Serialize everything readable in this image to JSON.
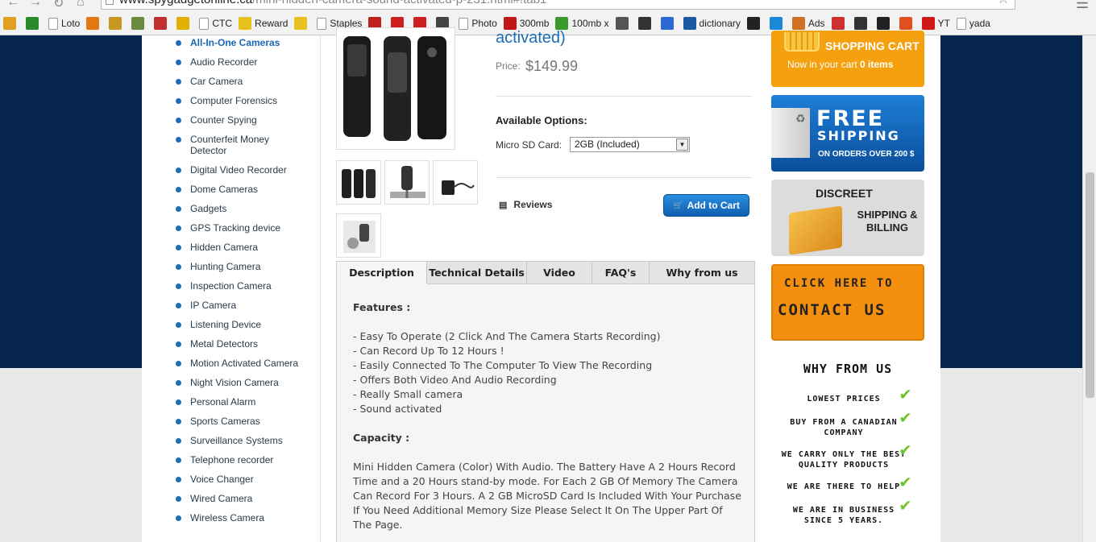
{
  "browser": {
    "url_host": "www.spygadgetonline.ca",
    "url_path": "/mini-hidden-camera-sound-activated-p-231.html#!tab1",
    "bookmarks": [
      {
        "label": "",
        "icon": "fuel-icon",
        "color": "#e0a020"
      },
      {
        "label": "",
        "icon": "td-icon",
        "color": "#2a8a2a"
      },
      {
        "label": "Loto",
        "icon": "page-icon"
      },
      {
        "label": "",
        "icon": "arrow-icon",
        "color": "#e07a10"
      },
      {
        "label": "",
        "icon": "house-icon",
        "color": "#c89820"
      },
      {
        "label": "",
        "icon": "box-icon",
        "color": "#6a8a40"
      },
      {
        "label": "",
        "icon": "star-badge-icon",
        "color": "#c03030"
      },
      {
        "label": "",
        "icon": "spark-icon",
        "color": "#e0b000"
      },
      {
        "label": "CTC",
        "icon": "page-icon"
      },
      {
        "label": "Reward",
        "icon": "folder-icon",
        "color": "#e8c020"
      },
      {
        "label": "",
        "icon": "folder-icon",
        "color": "#e8c020"
      },
      {
        "label": "Staples",
        "icon": "page-icon"
      },
      {
        "label": "",
        "icon": "play-icon",
        "color": "#c02020"
      },
      {
        "label": "",
        "icon": "grid-icon",
        "color": "#cc2020"
      },
      {
        "label": "",
        "icon": "b-icon",
        "color": "#cc2020"
      },
      {
        "label": "",
        "icon": "camera-icon",
        "color": "#444444"
      },
      {
        "label": "Photo",
        "icon": "page-icon"
      },
      {
        "label": "300mb",
        "icon": "film-icon",
        "color": "#c01818"
      },
      {
        "label": "100mb x",
        "icon": "go-icon",
        "color": "#3a9a2a"
      },
      {
        "label": "",
        "icon": "wikipedia-icon",
        "color": "#555555"
      },
      {
        "label": "",
        "icon": "free-icon",
        "color": "#333333"
      },
      {
        "label": "",
        "icon": "a-icon",
        "color": "#2a6ad0"
      },
      {
        "label": "dictionary",
        "icon": "wave-icon",
        "color": "#1a5aa0"
      },
      {
        "label": "",
        "icon": "hd-icon",
        "color": "#222222"
      },
      {
        "label": "",
        "icon": "circle-play-icon",
        "color": "#1a8ad8"
      },
      {
        "label": "Ads",
        "icon": "pie-icon",
        "color": "#d07020"
      },
      {
        "label": "",
        "icon": "k-icon",
        "color": "#cc3030"
      },
      {
        "label": "",
        "icon": "flag-icon",
        "color": "#333333"
      },
      {
        "label": "",
        "icon": "amazon-icon",
        "color": "#222222"
      },
      {
        "label": "",
        "icon": "sj-icon",
        "color": "#e05020"
      },
      {
        "label": "YT",
        "icon": "youtube-icon",
        "color": "#d01818"
      },
      {
        "label": "yada",
        "icon": "page-icon"
      }
    ]
  },
  "categories": [
    {
      "label": "All-In-One Cameras",
      "active": true
    },
    {
      "label": "Audio Recorder"
    },
    {
      "label": "Car Camera"
    },
    {
      "label": "Computer Forensics"
    },
    {
      "label": "Counter Spying"
    },
    {
      "label": "Counterfeit Money Detector"
    },
    {
      "label": "Digital Video Recorder"
    },
    {
      "label": "Dome Cameras"
    },
    {
      "label": "Gadgets"
    },
    {
      "label": "GPS Tracking device"
    },
    {
      "label": "Hidden Camera"
    },
    {
      "label": "Hunting Camera"
    },
    {
      "label": "Inspection Camera"
    },
    {
      "label": "IP Camera"
    },
    {
      "label": "Listening Device"
    },
    {
      "label": "Metal Detectors"
    },
    {
      "label": "Motion Activated Camera"
    },
    {
      "label": "Night Vision Camera"
    },
    {
      "label": "Personal Alarm"
    },
    {
      "label": "Sports Cameras"
    },
    {
      "label": "Surveillance Systems"
    },
    {
      "label": "Telephone recorder"
    },
    {
      "label": "Voice Changer"
    },
    {
      "label": "Wired Camera"
    },
    {
      "label": "Wireless Camera"
    }
  ],
  "product": {
    "title_tail": "activated)",
    "price_label": "Price:",
    "price": "$149.99",
    "options_title": "Available Options:",
    "option_label": "Micro SD Card:",
    "option_value": "2GB (Included)",
    "reviews_label": "Reviews",
    "add_to_cart": "Add to Cart"
  },
  "tabs": [
    {
      "label": "Description",
      "active": true
    },
    {
      "label": "Technical Details"
    },
    {
      "label": "Video"
    },
    {
      "label": "FAQ's"
    },
    {
      "label": "Why from us"
    }
  ],
  "description": {
    "features_title": "Features :",
    "features": [
      "- Easy To Operate (2 Click And The Camera Starts Recording)",
      "- Can Record Up To 12 Hours !",
      "- Easily Connected To The Computer To View The Recording",
      "- Offers Both Video And Audio Recording",
      "- Really Small camera",
      "- Sound activated"
    ],
    "capacity_title": "Capacity :",
    "capacity_text": "Mini Hidden Camera (Color) With Audio. The Battery Have A 2 Hours Record Time and a 20 Hours stand-by mode. For Each 2 GB Of Memory The Camera Can Record For 3 Hours. A 2 GB MicroSD Card Is Included With Your Purchase If You Need Additional Memory Size Please Select It On The Upper Part Of The Page."
  },
  "sidebar": {
    "cart_title": "SHOPPING CART",
    "cart_text_prefix": "Now in your cart",
    "cart_count": "0 items",
    "ship_line1": "FREE",
    "ship_line2": "SHIPPING",
    "ship_line3": "ON ORDERS OVER 200 $",
    "discreet_title": "DISCREET",
    "discreet_sub": "SHIPPING & BILLING",
    "contact_line1": "CLICK HERE TO",
    "contact_line2": "CONTACT US",
    "why_title": "WHY FROM US",
    "why_items": [
      "LOWEST PRICES",
      "BUY FROM A CANADIAN COMPANY",
      "WE CARRY ONLY THE BEST QUALITY PRODUCTS",
      "WE ARE THERE TO HELP",
      "WE ARE IN BUSINESS SINCE 5 YEARS."
    ]
  },
  "colors": {
    "navy_background": "#06264d",
    "link_blue": "#1668b8",
    "cart_orange": "#f5a00e",
    "check_green": "#6cc427"
  }
}
